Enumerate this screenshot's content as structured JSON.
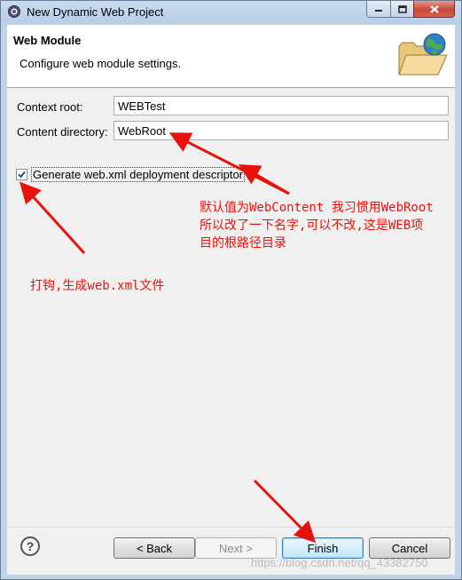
{
  "window": {
    "title": "New Dynamic Web Project"
  },
  "header": {
    "title": "Web Module",
    "description": "Configure web module settings."
  },
  "fields": [
    {
      "label": "Context root:",
      "value": "WEBTest"
    },
    {
      "label": "Content directory:",
      "value": "WebRoot"
    }
  ],
  "checkbox": {
    "label": "Generate web.xml deployment descriptor",
    "checked": true
  },
  "annotations": {
    "content_note_line1": "默认值为WebContent 我习惯用WebRoot",
    "content_note_line2": "所以改了一下名字,可以不改,这是WEB项",
    "content_note_line3": "目的根路径目录",
    "checkbox_note": "打钩,生成web.xml文件",
    "color": "#e8120c"
  },
  "footer": {
    "help_label": "?",
    "back_label": "< Back",
    "next_label": "Next >",
    "finish_label": "Finish",
    "cancel_label": "Cancel"
  },
  "watermark": "https://blog.csdn.net/qq_43382750"
}
